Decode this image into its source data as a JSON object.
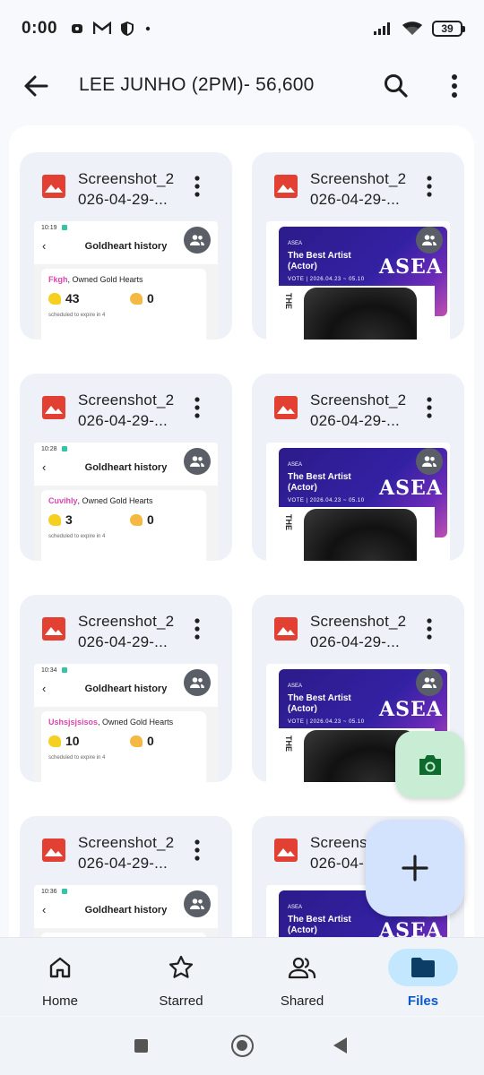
{
  "status_bar": {
    "time": "0:00",
    "battery": "39",
    "left_icons": [
      "game-icon",
      "gmail-icon",
      "shield-icon",
      "dot-icon"
    ],
    "right_icons": [
      "signal-icon",
      "wifi-icon",
      "battery-icon"
    ]
  },
  "top_bar": {
    "title": "LEE JUNHO (2PM)- 56,600",
    "back_icon": "arrow-back-icon",
    "search_icon": "search-icon",
    "more_icon": "more-vert-icon"
  },
  "files": [
    {
      "name": "Screenshot_2\n026-04-29-...",
      "thumb_type": "goldheart",
      "thumb": {
        "time": "10:19",
        "title": "Goldheart history",
        "user": "Fkgh",
        "owned_label": ", Owned Gold Hearts",
        "hearts": "43",
        "half": "0",
        "expire": "scheduled to expire in 4"
      }
    },
    {
      "name": "Screenshot_2\n026-04-29-...",
      "thumb_type": "asea",
      "thumb": {
        "small": "ASEA",
        "title_line1": "The Best Artist",
        "title_line2": "(Actor)",
        "vote": "VOTE | 2026.04.23 ~ 05.10",
        "logo": "ASEA",
        "strip": "THE"
      }
    },
    {
      "name": "Screenshot_2\n026-04-29-...",
      "thumb_type": "goldheart",
      "thumb": {
        "time": "10:28",
        "title": "Goldheart history",
        "user": "Cuvihly",
        "owned_label": ", Owned Gold Hearts",
        "hearts": "3",
        "half": "0",
        "expire": "scheduled to expire in 4"
      }
    },
    {
      "name": "Screenshot_2\n026-04-29-...",
      "thumb_type": "asea",
      "thumb": {
        "small": "ASEA",
        "title_line1": "The Best Artist",
        "title_line2": "(Actor)",
        "vote": "VOTE | 2026.04.23 ~ 05.10",
        "logo": "ASEA",
        "strip": "THE"
      }
    },
    {
      "name": "Screenshot_2\n026-04-29-...",
      "thumb_type": "goldheart",
      "thumb": {
        "time": "10:34",
        "title": "Goldheart history",
        "user": "Ushsjsjsisos",
        "owned_label": ", Owned Gold Hearts",
        "hearts": "10",
        "half": "0",
        "expire": "scheduled to expire in 4"
      }
    },
    {
      "name": "Screenshot_2\n026-04-29-...",
      "thumb_type": "asea",
      "thumb": {
        "small": "ASEA",
        "title_line1": "The Best Artist",
        "title_line2": "(Actor)",
        "vote": "VOTE | 2026.04.23 ~ 05.10",
        "logo": "ASEA",
        "strip": "THE"
      }
    },
    {
      "name": "Screenshot_2\n026-04-29-...",
      "thumb_type": "goldheart",
      "thumb": {
        "time": "10:36",
        "title": "Goldheart history",
        "user": "",
        "owned_label": "",
        "hearts": "",
        "half": "",
        "expire": ""
      }
    },
    {
      "name": "Screensh\n026-04-",
      "thumb_type": "asea",
      "thumb": {
        "small": "ASEA",
        "title_line1": "The Best Artist",
        "title_line2": "(Actor)",
        "vote": "",
        "logo": "ASEA",
        "strip": ""
      }
    }
  ],
  "fab": {
    "camera_icon": "camera-icon",
    "add_icon": "add-icon"
  },
  "bottom_nav": {
    "items": [
      {
        "label": "Home",
        "icon": "home-icon",
        "active": false
      },
      {
        "label": "Starred",
        "icon": "star-icon",
        "active": false
      },
      {
        "label": "Shared",
        "icon": "people-icon",
        "active": false
      },
      {
        "label": "Files",
        "icon": "folder-icon",
        "active": true
      }
    ]
  },
  "colors": {
    "accent": "#0b57d0",
    "active_pill": "#c2e7ff",
    "file_icon": "#e14033",
    "fab_camera": "#c9ecd4",
    "fab_add": "#d3e3fd"
  }
}
